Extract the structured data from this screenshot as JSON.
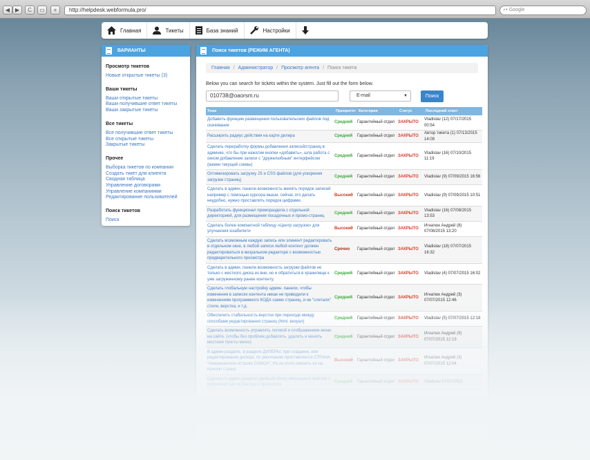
{
  "browser": {
    "url": "http://helpdesk.webformula.pro/",
    "search_placeholder": "Google",
    "back": "◀",
    "forward": "▶",
    "reload": "C",
    "add": "+"
  },
  "nav": {
    "items": [
      {
        "label": "Главная",
        "icon": "home-icon"
      },
      {
        "label": "Тикеты",
        "icon": "user-icon"
      },
      {
        "label": "База знаний",
        "icon": "document-icon"
      },
      {
        "label": "Настройки",
        "icon": "wrench-icon"
      },
      {
        "label": "",
        "icon": "download-arrow-icon"
      }
    ]
  },
  "sidebar": {
    "title": "ВАРИАНТЫ",
    "groups": [
      {
        "title": "Просмотр тикетов",
        "links": [
          "Новые открытые тикеты (3)"
        ]
      },
      {
        "title": "Ваши тикеты",
        "links": [
          "Ваши открытые тикеты",
          "Ваши получившие ответ тикеты",
          "Ваши закрытые тикеты"
        ]
      },
      {
        "title": "Все тикеты",
        "links": [
          "Все получившие ответ тикеты",
          "Все открытые тикеты",
          "Закрытые тикеты"
        ]
      },
      {
        "title": "Прочее",
        "links": [
          "Выборка тикетов по компании",
          "Создать тикет для клиента",
          "Сводная таблица",
          "Управление договорами",
          "Управление компаниями",
          "Редактирование пользователей"
        ]
      },
      {
        "title": "Поиск тикетов",
        "links": [
          "Поиск"
        ]
      }
    ]
  },
  "main": {
    "title": "Поиск тикетов (РЕЖИМ АГЕНТА)",
    "breadcrumb": [
      "Главная",
      "Администратор",
      "Просмотр агента",
      "Поиск тикета"
    ],
    "intro": "Below you can search for tickets within the system. Just fill out the form below.",
    "search_value": "010738@oaorsm.ru",
    "select_value": "E-mail",
    "search_button": "Поиск"
  },
  "colors": {
    "medium": "#39a93a",
    "high": "#d3361f",
    "urgent": "#b2261b",
    "closed": "#e03a2a",
    "accent": "#4ba3e0"
  },
  "table": {
    "headers": [
      "Тема",
      "Приоритет",
      "Категория",
      "Статус",
      "Последний ответ"
    ],
    "rows": [
      {
        "subject": "Добавить функцию размещения пользовательских файлов под скачивание",
        "priority": "Средний",
        "pclass": "medium",
        "category": "Гарантийный отдел",
        "status": "ЗАКРЫТО",
        "last": "Vladislav (12) 07/17/2015 00:54"
      },
      {
        "subject": "Расширить радиус действия на карте дилера",
        "priority": "Средний",
        "pclass": "medium",
        "category": "Гарантийный отдел",
        "status": "ЗАКРЫТО",
        "last": "Автор тикета (1) 07/13/2015 14:09"
      },
      {
        "subject": "Сделать переработку формы добавления записей/страниц в админке, что бы при нажатии кнопки «добавить», шла работа с окном добавление записи с \"дружелюбным\" интерфейсом (вамен текущей схемы)",
        "priority": "Средний",
        "pclass": "medium",
        "category": "Гарантийный отдел",
        "status": "ЗАКРЫТО",
        "last": "Vladislav (16) 07/10/2015 11:19"
      },
      {
        "subject": "Оптимизировать загрузку JS и CSS файлов (для ускорения загрузки страниц)",
        "priority": "Средний",
        "pclass": "medium",
        "category": "Гарантийный отдел",
        "status": "ЗАКРЫТО",
        "last": "Vladislav (9) 07/09/2015 16:56"
      },
      {
        "subject": "Сделать в админ. панели возможность менять порядок записей например с помощью курсора мыши, сейчас это делать неудобно, нужно проставлять порядок цифрами.",
        "priority": "Высокий",
        "pclass": "high",
        "category": "Гарантийный отдел",
        "status": "ЗАКРЫТО",
        "last": "Vladislav (9) 07/09/2015 10:51"
      },
      {
        "subject": "Разработать функционал проморазделa с отдельной директорией, для размещения посадочных и промо-страниц",
        "priority": "Средний",
        "pclass": "medium",
        "category": "Гарантийный отдел",
        "status": "ЗАКРЫТО",
        "last": "Vladislav (16) 07/08/2015 13:53"
      },
      {
        "subject": "Сделать более компактной таблицу «Центр загрузок» для улучшения юзабилити",
        "priority": "Высокий",
        "pclass": "high",
        "category": "Гарантийный отдел",
        "status": "ЗАКРЫТО",
        "last": "Игнатюк Андрей (8) 07/08/2015 13:20"
      },
      {
        "subject": "Сделать возможным каждую запись или элемент редактировать в отдельном окне, в любой записи любой контент должен редактироваться в визуальном редакторе с возможностью предварительного просмотра",
        "priority": "Срочно",
        "pclass": "urgent",
        "category": "Гарантийный отдел",
        "status": "ЗАКРЫТО",
        "last": "Vladislav (18) 07/07/2015 16:32"
      },
      {
        "subject": "Сделать в админ. панели возможность загрузки файлов не только с жесткого диска из вне, но и обратиться в хранилище к уже загруженному ранее контенту.",
        "priority": "Средний",
        "pclass": "medium",
        "category": "Гарантийный отдел",
        "status": "ЗАКРЫТО",
        "last": "Vladislav (4) 07/07/2015 16:02"
      },
      {
        "subject": "Сделать глобальную настройку админ. панели, чтобы изменения в записях контента никак не приводили к изменениям программного КОДА самих страниц, и не \"слетали\" стили, верстка, и т.д.",
        "priority": "Средний",
        "pclass": "medium",
        "category": "Гарантийный отдел",
        "status": "ЗАКРЫТО",
        "last": "Игнатюк Андрей (3) 07/07/2015 12:46"
      },
      {
        "subject": "Обеспечить стабильность верстки при переходе между способами редактирования страниц (html, визуал)",
        "priority": "Средний",
        "pclass": "medium",
        "category": "Гарантийный отдел",
        "status": "ЗАКРЫТО",
        "last": "Vladislav (5) 07/07/2015 12:18"
      },
      {
        "subject": "Сделать возможность управлять логикой и отображением меню на сайте. (чтобы без проблем добавлять, удалять и менять местами пункты меню)",
        "priority": "Средний",
        "pclass": "medium",
        "category": "Гарантийный отдел",
        "status": "ЗАКРЫТО",
        "last": "Игнатюк Андрей (9) 07/07/2015 12:19"
      },
      {
        "subject": "В админ-разделе, в разделе ДИЛЕРЫ, при создании, или редактировании дилера, по умолчанию проставляется СТРАНА \"Американское острова САМОА\". Из-за этого сменить ее на нужную страну",
        "priority": "Высокий",
        "pclass": "high",
        "category": "Гарантийный отдел",
        "status": "ЗАКРЫТО",
        "last": "Игнатюк Андрей (3) 07/07/2015 12:04"
      },
      {
        "subject": "Сделать в админ-разделе удобный обзор имеющихся файлов с возможностью их быстрого просмотра",
        "priority": "Средний",
        "pclass": "medium",
        "category": "Гарантийный отдел",
        "status": "ЗАКРЫТО",
        "last": "Vladislav 07/07/2015"
      }
    ]
  }
}
